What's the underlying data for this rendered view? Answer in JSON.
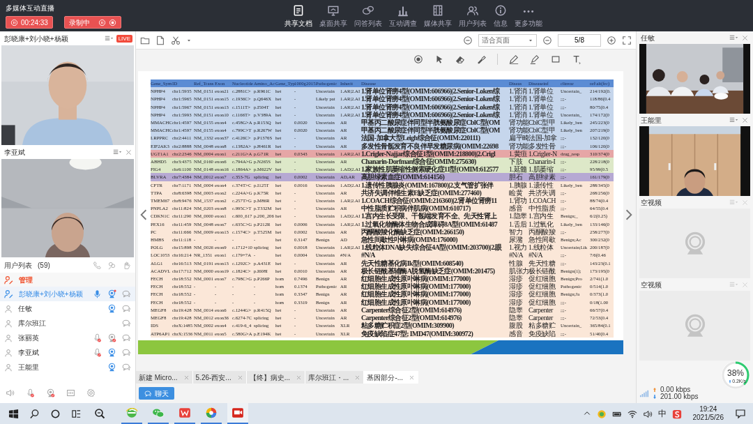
{
  "window": {
    "title": "多媒体互动直播"
  },
  "timer": {
    "time": "00:24:33"
  },
  "recording": {
    "label": "录制中"
  },
  "nav": [
    {
      "label": "共享文档",
      "selected": true
    },
    {
      "label": "桌面共享",
      "selected": false
    },
    {
      "label": "问答列表",
      "selected": false
    },
    {
      "label": "互动调查",
      "selected": false
    },
    {
      "label": "媒体共享",
      "selected": false
    },
    {
      "label": "用户列表",
      "selected": false
    },
    {
      "label": "信息",
      "selected": false
    },
    {
      "label": "更多功能",
      "selected": false
    }
  ],
  "left_videos": [
    {
      "name": "彭晓康+刘小晓+杨颖",
      "badge": "LIVE",
      "closable": false
    },
    {
      "name": "李亚斌",
      "closable": true
    }
  ],
  "user_list": {
    "title": "用户列表",
    "count": "(59)",
    "group": "管理",
    "users": [
      {
        "name": "彭晓康+刘小晓+杨颖",
        "highlighted": true,
        "mic": true,
        "camera": true,
        "camera_dot": true
      },
      {
        "name": "任敏",
        "highlighted": false,
        "camera": true,
        "camera_dot": false
      },
      {
        "name": "库尔班江",
        "highlighted": false
      },
      {
        "name": "张丽英",
        "highlighted": false,
        "mic": false,
        "camera": false
      },
      {
        "name": "李亚斌",
        "highlighted": false,
        "mic": false,
        "camera": true,
        "camera_dot": false
      },
      {
        "name": "王能里",
        "highlighted": false,
        "camera": true,
        "camera_dot": false
      }
    ]
  },
  "viewer": {
    "zoom": "适合页面",
    "page": "5/8"
  },
  "table": {
    "columns": [
      "Gene_Sym",
      "ID",
      "Ref_Trans",
      "Exon",
      "Nucleotide",
      "Amino_Ac",
      "Gene_Typ",
      "1000g2015",
      "Pathogenic",
      "Inherit",
      "Disease",
      "Diseas",
      "Diseaseinf",
      "clinvar",
      "ref\\alt(frc)"
    ],
    "rows": [
      {
        "color": "#c6d6ec",
        "cells": [
          "NPHP4",
          "chr1:5935",
          "NM_0151",
          "exon21",
          "c.2881C>",
          "p.R961C",
          "het",
          "-",
          "Uncertain",
          "1.AR|2.AI",
          "1.肾单位肾痨4型(OMIM:606966)|2.Senior-Loken综",
          "1.肾消",
          "1.肾单位",
          "Uncertain_",
          "214/192(0."
        ]
      },
      {
        "color": "#c6d6ec",
        "cells": [
          "NPHP4",
          "chr1:5965",
          "NM_0151",
          "exon15",
          "c.1936C>",
          "p.Q646X",
          "het",
          "-",
          "Likely pat",
          "1.AR|2.AI",
          "1.肾单位肾痨4型(OMIM:606966)|2.Senior-Loken综",
          "1.肾消",
          "1.肾单位",
          ";;;-",
          "118/86(0.4"
        ]
      },
      {
        "color": "#c6d6ec",
        "cells": [
          "NPHP4",
          "chr1:5967",
          "NM_0151",
          "exon13",
          "c.1511T>",
          "p.I504T",
          "het",
          "-",
          "Uncertain",
          "1.AR|2.AI",
          "1.肾单位肾痨4型(OMIM:606966)|2.Senior-Loken综",
          "1.肾消",
          "1.肾单位",
          ";;;-",
          "80/75(0.4"
        ]
      },
      {
        "color": "#c6d6ec",
        "cells": [
          "NPHP4",
          "chr1:5993",
          "NM_0151",
          "exon10",
          "c.1166T>",
          "p.V389A",
          "het",
          "-",
          "Uncertain",
          "1.AR|2.AI",
          "1.肾单位肾痨4型(OMIM:606966)|2.Senior-Loken综",
          "1.肾消",
          "1.肾单位",
          "Uncertain_",
          "174/172(0"
        ]
      },
      {
        "color": "#c6d6ec",
        "cells": [
          "MMACHC",
          "chr1:4597",
          "NM_0155",
          "exon4",
          "c.458G>A",
          "p.R153Q",
          "het",
          "0.0020",
          "Uncertain",
          "AR",
          "甲基丙二酸尿症伴同型半胱氨酸尿症CblC型(OM",
          "肾功能",
          "CblC型甲",
          "Likely_ben",
          "245/223(0"
        ]
      },
      {
        "color": "#c6d6ec",
        "cells": [
          "MMACHC",
          "chr1:4597",
          "NM_0155",
          "exon4",
          "c.799C>T",
          "p.R267W",
          "het",
          "0.0020",
          "Uncertain",
          "AR",
          "甲基丙二酸尿症伴同型半胱氨酸尿症CblC型(OM",
          "肾功能",
          "CblC型甲",
          "Likely_ben",
          "207/219(0"
        ]
      },
      {
        "color": "#c6d6ec",
        "cells": [
          "LRPPRC",
          "chr2:4411",
          "NM_1332",
          "exon37",
          "c.4126C>",
          "p.P1376S",
          "het",
          "-",
          "Uncertain",
          "AR",
          "法国-加拿大型Leigh综合征(OMIM:220111)",
          "扁平畸",
          "法国-加拿",
          ";;;-",
          "132/120(0"
        ]
      },
      {
        "color": "#c6d6ec",
        "cells": [
          "EIF2AK3",
          "chr2:8888",
          "NM_0048",
          "exon8",
          "c.1382A>",
          "p.H461R",
          "het",
          "-",
          "Uncertain",
          "AR",
          "多发性骨骺发育不良伴早发糖尿病(OMIM:22698",
          "肾功能",
          "多发性骨",
          ";;;-",
          "106/120(0"
        ]
      },
      {
        "color": "#e6a6a6",
        "cells": [
          "UGT1A1",
          "chr2:2346",
          "NM_0004",
          "exon1",
          "c.211G>A",
          "p.G71R",
          "het",
          "0.0343",
          "Uncertain",
          "1.AR|2.AI",
          "1.Crigler-Najjar综合征1型(OMIM:218800)|2.Crigl",
          "1.黄疸",
          "1.Crigler-N",
          "drug_resp",
          "310/374(0"
        ]
      },
      {
        "color": "#dde8c8",
        "cells": [
          "ABHD5",
          "chr3:4375",
          "NM_0160",
          "exon6",
          "c.794A>G",
          "p.N265S",
          "het",
          "-",
          "Uncertain",
          "AR",
          "Chanarin-Dorfman综合征(OMIM:275630)",
          "下肢",
          "Chanarin-I",
          ";;;-",
          "228/218(0"
        ]
      },
      {
        "color": "#dde8c8",
        "cells": [
          "FIG4",
          "chr6:1100",
          "NM_0148",
          "exon16",
          "c.1864A>",
          "p.M622V",
          "het",
          "-",
          "Uncertain",
          "1.AD|2.AI",
          "1.家族性肌萎缩性侧索硬化症11型(OMIM:612577",
          "1.延髓",
          "1.肌萎缩",
          ";;;-",
          "95/99(0.5"
        ]
      },
      {
        "color": "#b6a9d3",
        "cells": [
          "BLVRA",
          "chr7:4384",
          "NM_0012",
          "exon7",
          "c.353-7G",
          "splicing",
          "het",
          "0.0002",
          "Uncertain",
          "AD,AR",
          "高胆绿素血症(OMIM:614156)",
          "胆石",
          "高胆绿素",
          ";;;-",
          "161/179(0"
        ]
      },
      {
        "color": "#fbe7d8",
        "cells": [
          "CFTR",
          "chr7:1171",
          "NM_0004",
          "exon4",
          "c.374T>C",
          "p.I125T",
          "het",
          "0.0016",
          "Uncertain",
          "1.AD|2.AI",
          "1.遗传性胰腺炎(OMIM:167800)|2.支气管扩张伴",
          "1.胰腺",
          "1.遗传性",
          "Likely_ben",
          "288/345(0"
        ]
      },
      {
        "color": "#fbe7d8",
        "cells": [
          "TTPA",
          "chr8:6398",
          "NM_0003",
          "exon2",
          "c.224A>G",
          "p.K75R",
          "het",
          "-",
          "Uncertain",
          "AR",
          "共济失调伴维生素E缺乏症(OMIM:277460)",
          "睑黄",
          "共济失调",
          ";;;-",
          "268/256(0"
        ]
      },
      {
        "color": "#fbe7d8",
        "cells": [
          "TMEM67",
          "chr8:9476",
          "NM_1537",
          "exon2",
          "c.257T>G",
          "p.M86R",
          "het",
          "-",
          "Uncertain",
          "1.AR|2.AI",
          "1.COACH综合征(OMIM:216360)|2.肾单位肾痨11",
          "1.肾功",
          "1.COACH",
          ";;;-",
          "88/74(0.4"
        ]
      },
      {
        "color": "#fbe7d8",
        "cells": [
          "PNPLA2",
          "chr11:824",
          "NM_0203",
          "exon8",
          "c.995C>T",
          "p.T332M",
          "het",
          "-",
          "Uncertain",
          "AR",
          "中性脂质贮积病伴肌病(OMIM:610717)",
          "感音",
          "中性脂质",
          ";;;-",
          "64/55(0.4"
        ]
      },
      {
        "color": "#fbe7d8",
        "cells": [
          "CDKN1C",
          "chr11:290",
          "NM_0000",
          "exon1",
          "c.600_617",
          "p.200_206",
          "het",
          "-",
          "Uncertain",
          "1.AD|2.AI",
          "1.宫内生长受限、干骺端发育不全、先天性肾上",
          "1.隐睾",
          "1.宫内生",
          "Benign;_",
          "6/2(0.25)"
        ]
      },
      {
        "color": "#fbe7d8",
        "cells": [
          "PEX16",
          "chr11:459",
          "NM_0048",
          "exon7",
          "c.635C>G",
          "p.P212R",
          "het",
          "0.0006",
          "Uncertain",
          "1.AR|2.AI",
          "1.过氧化物酶体生物合成障碍8A型(OMIM:61487",
          "1.舌后",
          "1.过氧化",
          "Likely_ben",
          "133/146(0"
        ]
      },
      {
        "color": "#fbe7d8",
        "cells": [
          "PC",
          "chr11:666",
          "NM_0009",
          "exon13",
          "c.1574C>",
          "p.T525M",
          "het",
          "0.0002",
          "Uncertain",
          "AR",
          "丙酮酸羧化酶缺乏症(OMIM:266150)",
          "智力",
          "丙酮酸羧",
          ";;;-",
          "258/277(0"
        ]
      },
      {
        "color": "#fbe7d8",
        "cells": [
          "HMBS",
          "chr11:118",
          "-",
          "-",
          "-",
          "-",
          "het",
          "0.3147",
          "Benign",
          "AD",
          "急性间歇性卟啉病(OMIM:176000)",
          "尿潴",
          "急性间歇",
          "Benign;Ac",
          "300/232(0"
        ]
      },
      {
        "color": "#fbe7d8",
        "cells": [
          "POLG",
          "chr15:898",
          "NM_0026",
          "exon9",
          "c.1712+10",
          "splicing",
          "het",
          "0.0018",
          "Uncertain",
          "1.AR|2.AI",
          "1.线粒体DNA缺失综合征4A型(OMIM:203700)|2.眼",
          "1.视力",
          "1.线粒体",
          "Uncertain;Lik",
          "200/187(0"
        ]
      },
      {
        "color": "#fbe7d8",
        "cells": [
          "LOC1053",
          "chr16:214",
          "NR_1351",
          "exon1",
          "c.179+7A",
          "-",
          "het",
          "0.0004",
          "Uncertain",
          "#N/A",
          "#N/A",
          "#N/A",
          "#N/A",
          ";;;-",
          "7/6(0.46"
        ]
      },
      {
        "color": "#fbe7d8",
        "cells": [
          "ALG1",
          "chr16:513",
          "NM_0191",
          "exon13",
          "c.1292C>",
          "p.A431E",
          "het",
          "-",
          "Uncertain",
          "AR",
          "先天性糖基化病Ik型(OMIM:608540)",
          "性腺",
          "先天性糖",
          ";;;-",
          "143/23(0.1"
        ]
      },
      {
        "color": "#fbe7d8",
        "cells": [
          "ACADVL",
          "chr17:712",
          "NM_0000",
          "exon19",
          "c.1824C>",
          "p.I608I",
          "het",
          "0.0010",
          "Uncertain",
          "AR",
          "极长链酰基辅酶A脱氢酶缺乏症(OMIM:201475)",
          "肌张力",
          "极长链酰",
          "Benign(1);",
          "173/195(0"
        ]
      },
      {
        "color": "#fbe7d8",
        "cells": [
          "FECH",
          "chr18:552",
          "NM_0001",
          "exon7",
          "c.798C>G",
          "p.P266P",
          "hom",
          "0.7496",
          "Benign",
          "AR",
          "红细胞生成性原卟啉病(OMIM:177000)",
          "湿疹",
          "促红细胞",
          "Benign;Pro",
          "2/741(1.0"
        ]
      },
      {
        "color": "#fbe7d8",
        "cells": [
          "FECH",
          "chr18:552",
          "-",
          "-",
          "-",
          "-",
          "hom",
          "0.1374",
          "Pathogenic",
          "AR",
          "红细胞生成性原卟啉病(OMIM:177000)",
          "湿疹",
          "促红细胞",
          "Pathogenic",
          "0/514(1.0"
        ]
      },
      {
        "color": "#fbe7d8",
        "cells": [
          "FECH",
          "chr18:552",
          "-",
          "-",
          "-",
          "-",
          "hom",
          "0.3347",
          "Benign",
          "AR",
          "红细胞生成性原卟啉病(OMIM:177000)",
          "湿疹",
          "促红细胞",
          "Benign;Ja",
          "0/373(1.0"
        ]
      },
      {
        "color": "#fbe7d8",
        "cells": [
          "FECH",
          "chr18:552",
          "-",
          "-",
          "-",
          "-",
          "hom",
          "0.3319",
          "Benign",
          "AR",
          "红细胞生成性原卟啉病(OMIM:177000)",
          "湿疹",
          "促红细胞",
          ";;;-",
          "0/18(1.00"
        ]
      },
      {
        "color": "#fbe7d8",
        "cells": [
          "MEGF8",
          "chr19:428",
          "NM_0014",
          "exon6",
          "c.1244G>",
          "p.R415Q",
          "het",
          "-",
          "Uncertain",
          "AR",
          "Carpenter综合征2型(OMIM:614976)",
          "隐睾",
          "Carpenter",
          ";;;-",
          "66/57(0.4"
        ]
      },
      {
        "color": "#fbe7d8",
        "cells": [
          "MEGF8",
          "chr19:428",
          "NM_0012",
          "exon36",
          "c.6274-7C",
          "splicing",
          "het",
          "-",
          "Uncertain",
          "AR",
          "Carpenter综合征2型(OMIM:614976)",
          "隐睾",
          "Carpenter",
          ";;;-",
          "72/53(0.4"
        ]
      },
      {
        "color": "#fbe7d8",
        "cells": [
          "IDS",
          "chrX:1485",
          "NM_0002",
          "exon4",
          "c.419-6_4",
          "splicing",
          "het",
          "-",
          "Uncertain",
          "XLR",
          "粘多糖贮积症2型(OMIM:309900)",
          "腹股",
          "粘多糖贮",
          "Uncertain_",
          "365/84(0.1"
        ]
      },
      {
        "color": "#fbe7d8",
        "cells": [
          "ATP6AP1",
          "chrX:1536",
          "NM_0011",
          "exon5",
          "c.580G>A",
          "p.E194K",
          "het",
          "-",
          "Uncertain",
          "XLR",
          "免疫缺陷症47型; IMD47(OMIM:300972)",
          "感音",
          "免疫缺陷",
          ";;;-",
          "51/40(0.4"
        ]
      }
    ]
  },
  "doc_tabs": [
    {
      "label": "新建 Micro...",
      "selected": false
    },
    {
      "label": "5.26-西安...",
      "selected": false
    },
    {
      "label": "【终】病史...",
      "selected": false
    },
    {
      "label": "库尔班江・...",
      "selected": false
    },
    {
      "label": "基因部分-...",
      "selected": true
    }
  ],
  "chat_button": "聊天",
  "right_videos": [
    {
      "name": "任敏",
      "kind": "group"
    },
    {
      "name": "王能里",
      "kind": "single"
    },
    {
      "name": "空视频",
      "kind": "empty"
    },
    {
      "name": "空视频",
      "kind": "empty"
    }
  ],
  "network": {
    "percent": "38%",
    "level": 0.38,
    "speed": "0.2K/s",
    "upload": "0.00 kbps",
    "download": "201.00 kbps"
  },
  "taskbar": {
    "ime": "中",
    "time": "19:24",
    "date": "2021/5/26"
  }
}
